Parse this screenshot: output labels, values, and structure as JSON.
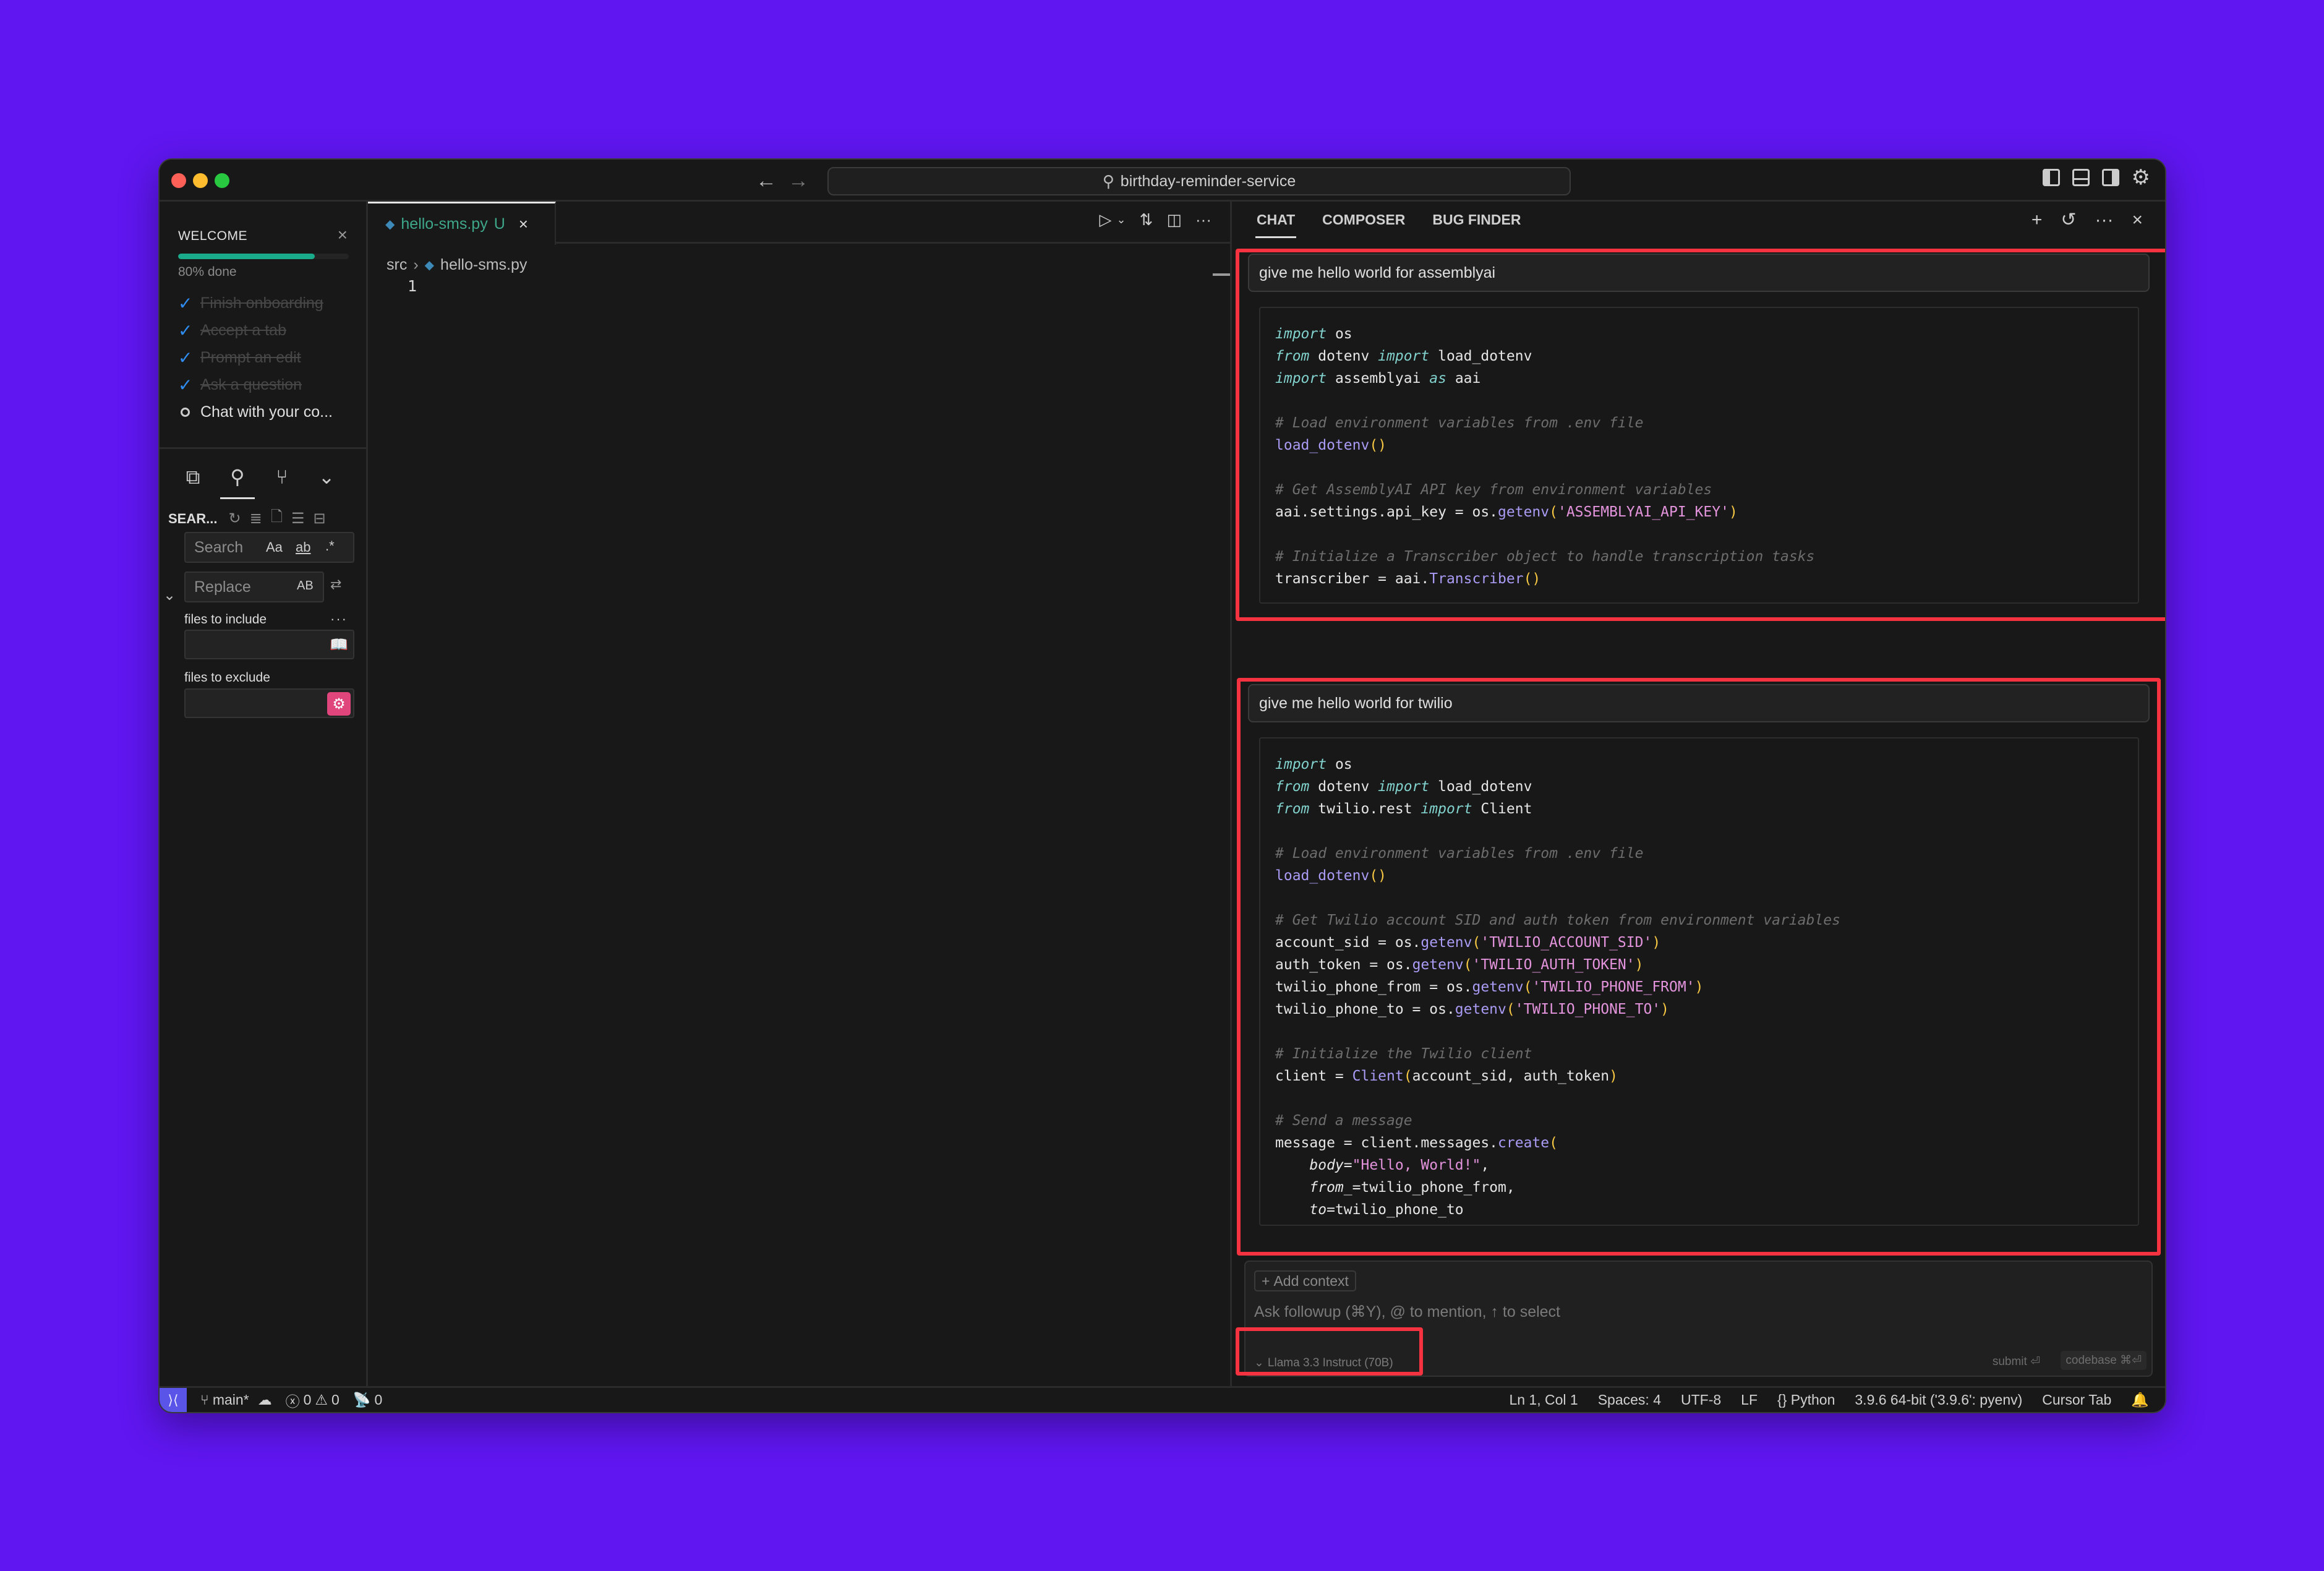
{
  "window": {
    "title": "birthday-reminder-service",
    "nav_back": "←",
    "nav_forward": "→"
  },
  "welcome": {
    "title": "WELCOME",
    "progress_percent": 80,
    "progress_label": "80% done",
    "steps": [
      {
        "label": "Finish onboarding",
        "done": true
      },
      {
        "label": "Accept a tab",
        "done": true
      },
      {
        "label": "Prompt an edit",
        "done": true
      },
      {
        "label": "Ask a question",
        "done": true
      },
      {
        "label": "Chat with your co...",
        "done": false
      }
    ]
  },
  "search_panel": {
    "title": "SEAR...",
    "search_placeholder": "Search",
    "replace_placeholder": "Replace",
    "match_case": "Aa",
    "whole_word": "ab",
    "regex": ".*",
    "preserve_case": "AB",
    "files_to_include_label": "files to include",
    "files_to_exclude_label": "files to exclude",
    "files_to_include_value": "",
    "files_to_exclude_value": ""
  },
  "editor": {
    "tab": {
      "filename": "hello-sms.py",
      "status": "U"
    },
    "breadcrumb": {
      "folder": "src",
      "file": "hello-sms.py"
    },
    "line_numbers": [
      "1"
    ]
  },
  "chat": {
    "tabs": [
      {
        "label": "CHAT",
        "active": true
      },
      {
        "label": "COMPOSER",
        "active": false
      },
      {
        "label": "BUG FINDER",
        "active": false
      }
    ],
    "messages": [
      {
        "prompt": "give me hello world for assemblyai",
        "code": [
          [
            [
              "kw",
              "import"
            ],
            [
              "t",
              " os"
            ]
          ],
          [
            [
              "kw",
              "from"
            ],
            [
              "t",
              " dotenv "
            ],
            [
              "kw",
              "import"
            ],
            [
              "t",
              " load_dotenv"
            ]
          ],
          [
            [
              "kw",
              "import"
            ],
            [
              "t",
              " assemblyai "
            ],
            [
              "kw",
              "as"
            ],
            [
              "t",
              " aai"
            ]
          ],
          [],
          [
            [
              "cm",
              "# Load environment variables from .env file"
            ]
          ],
          [
            [
              "fn",
              "load_dotenv"
            ],
            [
              "par",
              "()"
            ]
          ],
          [],
          [
            [
              "cm",
              "# Get AssemblyAI API key from environment variables"
            ]
          ],
          [
            [
              "t",
              "aai.settings.api_key = os."
            ],
            [
              "fn",
              "getenv"
            ],
            [
              "par",
              "("
            ],
            [
              "str",
              "'ASSEMBLYAI_API_KEY'"
            ],
            [
              "par",
              ")"
            ]
          ],
          [],
          [
            [
              "cm",
              "# Initialize a Transcriber object to handle transcription tasks"
            ]
          ],
          [
            [
              "t",
              "transcriber = aai."
            ],
            [
              "fn",
              "Transcriber"
            ],
            [
              "par",
              "()"
            ]
          ]
        ]
      },
      {
        "prompt": "give me hello world for twilio",
        "code": [
          [
            [
              "kw",
              "import"
            ],
            [
              "t",
              " os"
            ]
          ],
          [
            [
              "kw",
              "from"
            ],
            [
              "t",
              " dotenv "
            ],
            [
              "kw",
              "import"
            ],
            [
              "t",
              " load_dotenv"
            ]
          ],
          [
            [
              "kw",
              "from"
            ],
            [
              "t",
              " twilio.rest "
            ],
            [
              "kw",
              "import"
            ],
            [
              "t",
              " Client"
            ]
          ],
          [],
          [
            [
              "cm",
              "# Load environment variables from .env file"
            ]
          ],
          [
            [
              "fn",
              "load_dotenv"
            ],
            [
              "par",
              "()"
            ]
          ],
          [],
          [
            [
              "cm",
              "# Get Twilio account SID and auth token from environment variables"
            ]
          ],
          [
            [
              "t",
              "account_sid = os."
            ],
            [
              "fn",
              "getenv"
            ],
            [
              "par",
              "("
            ],
            [
              "str",
              "'TWILIO_ACCOUNT_SID'"
            ],
            [
              "par",
              ")"
            ]
          ],
          [
            [
              "t",
              "auth_token = os."
            ],
            [
              "fn",
              "getenv"
            ],
            [
              "par",
              "("
            ],
            [
              "str",
              "'TWILIO_AUTH_TOKEN'"
            ],
            [
              "par",
              ")"
            ]
          ],
          [
            [
              "t",
              "twilio_phone_from = os."
            ],
            [
              "fn",
              "getenv"
            ],
            [
              "par",
              "("
            ],
            [
              "str",
              "'TWILIO_PHONE_FROM'"
            ],
            [
              "par",
              ")"
            ]
          ],
          [
            [
              "t",
              "twilio_phone_to = os."
            ],
            [
              "fn",
              "getenv"
            ],
            [
              "par",
              "("
            ],
            [
              "str",
              "'TWILIO_PHONE_TO'"
            ],
            [
              "par",
              ")"
            ]
          ],
          [],
          [
            [
              "cm",
              "# Initialize the Twilio client"
            ]
          ],
          [
            [
              "t",
              "client = "
            ],
            [
              "fn",
              "Client"
            ],
            [
              "par",
              "("
            ],
            [
              "t",
              "account_sid, auth_token"
            ],
            [
              "par",
              ")"
            ]
          ],
          [],
          [
            [
              "cm",
              "# Send a message"
            ]
          ],
          [
            [
              "t",
              "message = client.messages."
            ],
            [
              "fn",
              "create"
            ],
            [
              "par",
              "("
            ]
          ],
          [
            [
              "t",
              "    "
            ],
            [
              "arg",
              "body"
            ],
            [
              "t",
              "="
            ],
            [
              "str",
              "\"Hello, World!\""
            ],
            [
              "t",
              ","
            ]
          ],
          [
            [
              "t",
              "    "
            ],
            [
              "arg",
              "from_"
            ],
            [
              "t",
              "=twilio_phone_from,"
            ]
          ],
          [
            [
              "t",
              "    "
            ],
            [
              "arg",
              "to"
            ],
            [
              "t",
              "=twilio_phone_to"
            ]
          ],
          [
            [
              "par",
              ")"
            ]
          ]
        ]
      }
    ],
    "composer": {
      "add_context": "Add context",
      "placeholder": "Ask followup (⌘Y), @ to mention, ↑ to select",
      "model": "Llama 3.3 Instruct (70B)",
      "submit_hint": "submit ⏎",
      "codebase_hint": "codebase ⌘⏎"
    }
  },
  "status_bar": {
    "branch": "main*",
    "errors": "0",
    "warnings": "0",
    "ports": "0",
    "cursor_position": "Ln 1, Col 1",
    "indentation": "Spaces: 4",
    "encoding": "UTF-8",
    "eol": "LF",
    "language": "Python",
    "interpreter": "3.9.6 64-bit ('3.9.6': pyenv)",
    "cursor_tab": "Cursor Tab"
  },
  "colors": {
    "background": "#5f16f0",
    "highlight_box": "#f5323f",
    "progress": "#1aab8a",
    "remote_indicator": "#5a55e8",
    "exclude_badge": "#e0457b"
  }
}
